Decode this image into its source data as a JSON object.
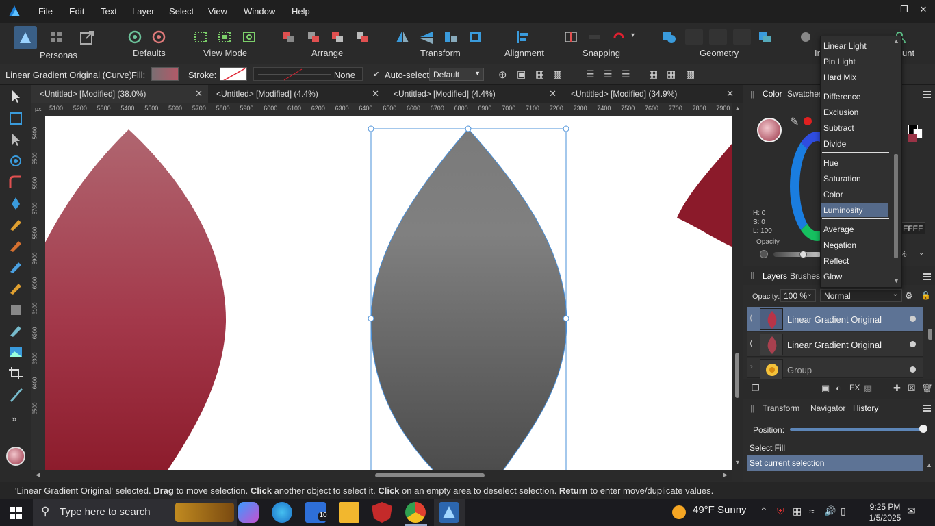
{
  "menubar": {
    "items": [
      "File",
      "Edit",
      "Text",
      "Layer",
      "Select",
      "View",
      "Window",
      "Help"
    ]
  },
  "toolbar": {
    "personas_label": "Personas",
    "defaults_label": "Defaults",
    "viewmode_label": "View Mode",
    "arrange_label": "Arrange",
    "transform_label": "Transform",
    "alignment_label": "Alignment",
    "snapping_label": "Snapping",
    "geometry_label": "Geometry",
    "insert_partial": "In",
    "account_partial": "unt"
  },
  "context": {
    "selection_label": "Linear Gradient Original (Curve)",
    "fill_label": "Fill:",
    "stroke_label": "Stroke:",
    "stroke_value": "None",
    "autoselect_label": "Auto-select:",
    "autoselect_value": "Default"
  },
  "tabs": [
    {
      "label": "<Untitled> [Modified] (38.0%)"
    },
    {
      "label": "<Untitled> [Modified] (4.4%)"
    },
    {
      "label": "<Untitled> [Modified] (4.4%)"
    },
    {
      "label": "<Untitled> [Modified] (34.9%)"
    }
  ],
  "ruler": {
    "unit": "px",
    "top_ticks": [
      "5100",
      "5200",
      "5300",
      "5400",
      "5500",
      "5600",
      "5700",
      "5800",
      "5900",
      "6000",
      "6100",
      "6200",
      "6300",
      "6400",
      "6500",
      "6600",
      "6700",
      "6800",
      "6900",
      "7000",
      "7100",
      "7200",
      "7300",
      "7400",
      "7500",
      "7600",
      "7700",
      "7800",
      "7900"
    ],
    "left_ticks": [
      "5400",
      "5500",
      "5600",
      "5700",
      "5800",
      "5900",
      "6000",
      "6100",
      "6200",
      "6300",
      "6400",
      "6500"
    ]
  },
  "color_panel": {
    "tabs": [
      "Color",
      "Swatches"
    ],
    "hsl": {
      "h": "H: 0",
      "s": "S: 0",
      "l": "L: 100"
    },
    "hex_partial": "FFFF",
    "opacity_label": "Opacity",
    "opacity_partial": "%"
  },
  "blend_modes": {
    "options": [
      {
        "label": "Linear Light"
      },
      {
        "label": "Pin Light"
      },
      {
        "label": "Hard Mix"
      },
      {
        "label": "Difference"
      },
      {
        "label": "Exclusion"
      },
      {
        "label": "Subtract"
      },
      {
        "label": "Divide"
      },
      {
        "label": "Hue"
      },
      {
        "label": "Saturation"
      },
      {
        "label": "Color"
      },
      {
        "label": "Luminosity"
      },
      {
        "label": "Average"
      },
      {
        "label": "Negation"
      },
      {
        "label": "Reflect"
      },
      {
        "label": "Glow"
      }
    ],
    "highlighted": "Luminosity"
  },
  "layers_panel": {
    "tabs": [
      "Layers",
      "Brushes"
    ],
    "opacity_label": "Opacity:",
    "opacity_value": "100 %",
    "blend_value": "Normal",
    "rows": [
      {
        "name": "Linear Gradient Original",
        "selected": true
      },
      {
        "name": "Linear Gradient Original",
        "selected": false
      },
      {
        "name": "Group",
        "selected": false
      }
    ]
  },
  "history_panel": {
    "tabs": [
      "Transform",
      "Navigator",
      "History"
    ],
    "position_label": "Position:",
    "position_value": 1.0,
    "entries": [
      "Select Fill",
      "Set current selection"
    ]
  },
  "status": {
    "p1": "'Linear Gradient Original' selected. ",
    "b1": "Drag",
    "p2": " to move selection. ",
    "b2": "Click",
    "p3": " another object to select it. ",
    "b3": "Click",
    "p4": " on an empty area to deselect selection. ",
    "b4": "Return",
    "p5": " to enter move/duplicate values."
  },
  "taskbar": {
    "search_placeholder": "Type here to search",
    "weather": "49°F  Sunny",
    "time": "9:25 PM",
    "date": "1/5/2025",
    "mail_badge": "10"
  },
  "colors": {
    "accent": "#5d7395",
    "selection_blue": "#4a90d9",
    "crimson": "#8b1a2a"
  }
}
